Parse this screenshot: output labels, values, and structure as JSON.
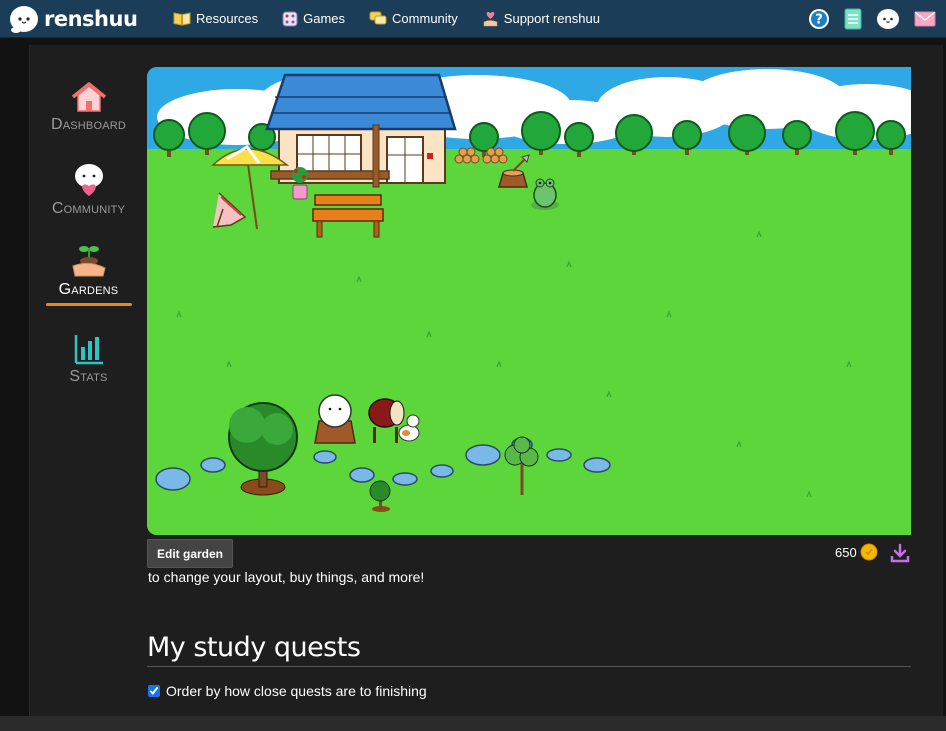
{
  "brand": {
    "name": "renshuu"
  },
  "nav": [
    {
      "label": "Resources",
      "icon": "book-icon"
    },
    {
      "label": "Games",
      "icon": "dice-icon"
    },
    {
      "label": "Community",
      "icon": "chat-bubbles-icon"
    },
    {
      "label": "Support renshuu",
      "icon": "heart-hand-icon"
    }
  ],
  "top_icons": [
    "help-icon",
    "notebook-icon",
    "mascot-icon",
    "mail-icon"
  ],
  "sidebar": [
    {
      "label": "Dashboard",
      "icon": "house-icon",
      "active": false
    },
    {
      "label": "Community",
      "icon": "mascot-heart-icon",
      "active": false
    },
    {
      "label": "Gardens",
      "icon": "sprout-hand-icon",
      "active": true
    },
    {
      "label": "Stats",
      "icon": "bar-chart-icon",
      "active": false
    }
  ],
  "garden": {
    "edit_button": "Edit garden",
    "coins": "650",
    "hint": "to change your layout, buy things, and more!"
  },
  "quests": {
    "title": "My study quests",
    "order_label": "Order by how close quests are to finishing",
    "order_checked": true
  },
  "colors": {
    "topbar": "#1b3d57",
    "accent_underline": "#e88a1a",
    "grass": "#5cd63a",
    "sky": "#2fa8e6"
  }
}
